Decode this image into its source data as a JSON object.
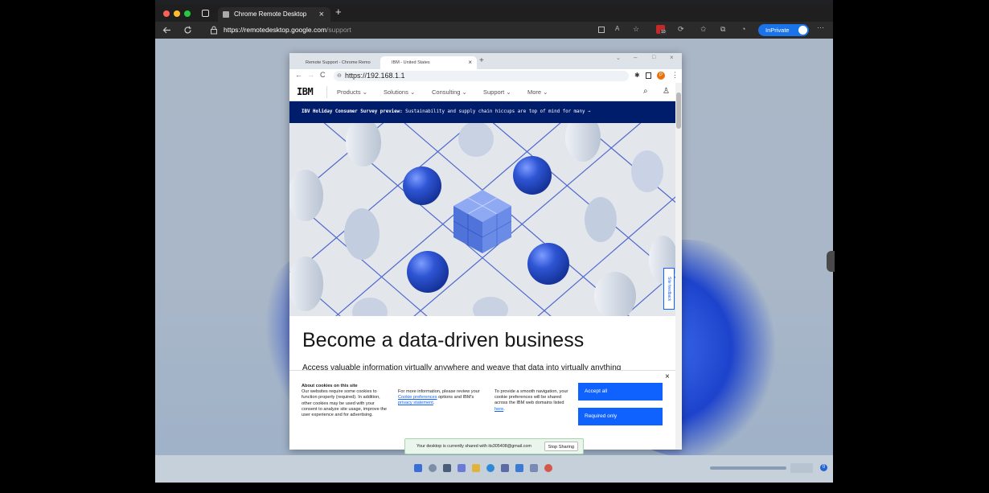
{
  "edge": {
    "tab_title": "Chrome Remote Desktop",
    "url_domain": "https://remotedesktop.google.com",
    "url_path": "/support",
    "inprivate_label": "InPrivate",
    "tab_close": "×",
    "new_tab": "+",
    "more": "···",
    "badge_count": "10"
  },
  "chrome": {
    "tabs": [
      {
        "label": "Remote Support - Chrome Remo",
        "active": false
      },
      {
        "label": "IBM - United States",
        "active": true
      }
    ],
    "url": "https://192.168.1.1",
    "profile_initial": "P"
  },
  "ibm": {
    "logo": "IBM",
    "nav": [
      "Products",
      "Solutions",
      "Consulting",
      "Support",
      "More"
    ],
    "banner_bold": "IBV Holiday Consumer Survey preview:",
    "banner_text": " Sustainability and supply chain hiccups are top of mind for many →",
    "hero_title": "Become a data-driven business",
    "hero_subtitle": "Access valuable information virtually anywhere and weave that data into virtually anything",
    "feedback_label": "Site feedback"
  },
  "cookie": {
    "heading": "About cookies on this site",
    "col1": "Our websites require some cookies to function properly (required). In addition, other cookies may be used with your consent to analyze site usage, improve the user experience and for advertising.",
    "col2_prefix": "For more information, please review your ",
    "col2_link1": "Cookie preferences",
    "col2_mid": " options and IBM's ",
    "col2_link2": "privacy statement",
    "col2_end": ".",
    "col3_prefix": "To provide a smooth navigation, your cookie preferences will be shared across the IBM web domains listed ",
    "col3_link": "here",
    "col3_end": ".",
    "accept_all": "Accept all",
    "required_only": "Required only",
    "close": "×"
  },
  "share": {
    "message": "Your desktop is currently shared with its305408@gmail.com",
    "stop": "Stop Sharing"
  },
  "taskbar": {
    "notification_count": "0"
  }
}
